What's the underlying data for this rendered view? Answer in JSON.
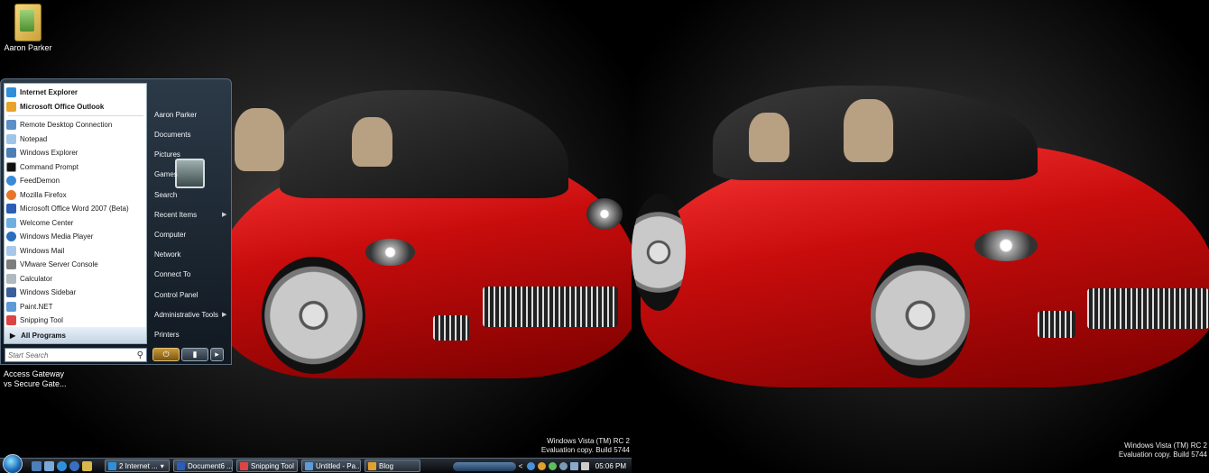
{
  "desktop": {
    "icon_label": "Aaron Parker",
    "partial_text_line1": "Access Gateway",
    "partial_text_line2": "vs Secure Gate...",
    "watermark_line1": "Windows Vista (TM) RC 2",
    "watermark_line2": "Evaluation copy. Build 5744"
  },
  "start_menu": {
    "pinned": [
      "Internet Explorer",
      "Microsoft Office Outlook"
    ],
    "recent": [
      "Remote Desktop Connection",
      "Notepad",
      "Windows Explorer",
      "Command Prompt",
      "FeedDemon",
      "Mozilla Firefox",
      "Microsoft Office Word 2007 (Beta)",
      "Welcome Center",
      "Windows Media Player",
      "Windows Mail",
      "VMware Server Console",
      "Calculator",
      "Windows Sidebar",
      "Paint.NET",
      "Snipping Tool"
    ],
    "all_programs": "All Programs",
    "search_placeholder": "Start Search",
    "right": {
      "user": "Aaron Parker",
      "documents": "Documents",
      "pictures": "Pictures",
      "games": "Games",
      "search": "Search",
      "recent_items": "Recent Items",
      "computer": "Computer",
      "network": "Network",
      "connect_to": "Connect To",
      "control_panel": "Control Panel",
      "admin_tools": "Administrative Tools",
      "printers": "Printers"
    }
  },
  "taskbar": {
    "tasks": [
      "2 Internet ...",
      "Document6 ...",
      "Snipping Tool",
      "Untitled - Pa...",
      "Blog"
    ],
    "clock": "05:06 PM"
  },
  "colors": {
    "car_red": "#c80c0c",
    "taskbar": "#0a0d12"
  }
}
